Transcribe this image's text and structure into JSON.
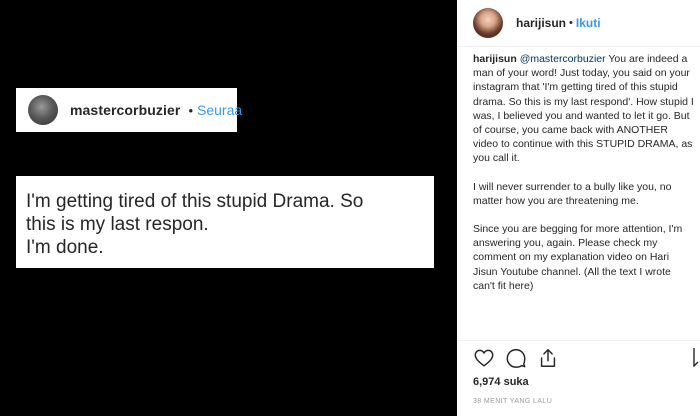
{
  "post_media": {
    "embed_username": "mastercorbuzier",
    "embed_separator": "•",
    "embed_follow": "Seuraa",
    "embed_text_lines": [
      "I'm getting tired of this stupid Drama. So",
      "this is my last respon.",
      "I'm done."
    ]
  },
  "panel": {
    "username": "harijisun",
    "separator": "•",
    "follow_label": "Ikuti",
    "caption": {
      "author": "harijisun",
      "mention": "@mastercorbuzier",
      "p1_rest": " You are indeed a man of your word! Just today, you said on your instagram that 'I'm getting tired of this stupid drama. So this is my last respond'. How stupid I was, I believed you and wanted to let it go. But of course, you came back with ANOTHER video to continue with this STUPID DRAMA, as you call it.",
      "p2": "I will never surrender to a bully like you, no matter how you are threatening me.",
      "p3": "Since you are begging for more attention, I'm answering you, again. Please check my comment on my explanation video on Hari Jisun Youtube channel. (All the text I wrote can't fit here)"
    },
    "actions": {
      "like_icon": "heart-icon",
      "comment_icon": "comment-icon",
      "share_icon": "share-icon",
      "save_icon": "bookmark-icon"
    },
    "likes": "6,974 suka",
    "timestamp": "38 MENIT YANG LALU"
  },
  "colors": {
    "media_bg": "#000000",
    "link_blue": "#3897f0",
    "mention": "#003569",
    "text": "#262626",
    "muted": "#999999"
  }
}
